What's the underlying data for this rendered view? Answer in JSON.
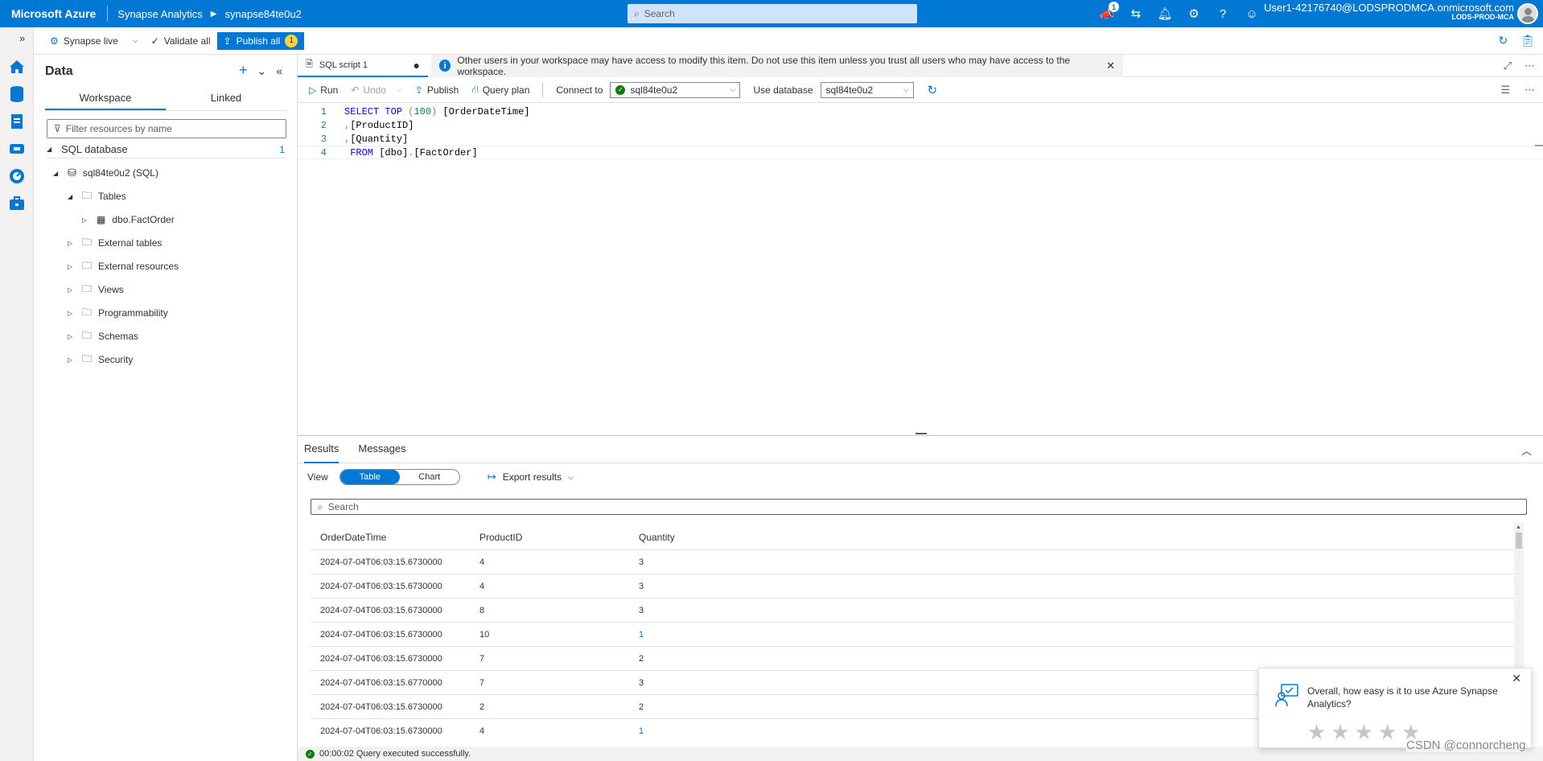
{
  "topbar": {
    "brand": "Microsoft Azure",
    "breadcrumb": [
      "Synapse Analytics",
      "synapse84te0u2"
    ],
    "search_placeholder": "Search",
    "notification_count": "1",
    "user_name": "User1-42176740@LODSPRODMCA.onmicrosoft.com",
    "user_tenant": "LODS-PROD-MCA"
  },
  "commandbar": {
    "mode": "Synapse live",
    "validate_all": "Validate all",
    "publish_all": "Publish all",
    "publish_count": "1"
  },
  "data_panel": {
    "title": "Data",
    "tabs": [
      "Workspace",
      "Linked"
    ],
    "filter_placeholder": "Filter resources by name",
    "section": "SQL database",
    "section_count": "1",
    "database": "sql84te0u2 (SQL)",
    "tables_folder": "Tables",
    "table_item": "dbo.FactOrder",
    "folders": [
      "External tables",
      "External resources",
      "Views",
      "Programmability",
      "Schemas",
      "Security"
    ]
  },
  "editor": {
    "tab_label": "SQL script 1",
    "tab_modified": "●",
    "info_message": "Other users in your workspace may have access to modify this item. Do not use this item unless you trust all users who may have access to the workspace.",
    "toolbar": {
      "run": "Run",
      "undo": "Undo",
      "publish": "Publish",
      "query_plan": "Query plan",
      "connect_to_label": "Connect to",
      "connect_to_value": "sql84te0u2",
      "use_database_label": "Use database",
      "use_database_value": "sql84te0u2"
    },
    "line_numbers": [
      "1",
      "2",
      "3",
      "4"
    ]
  },
  "results": {
    "tabs": [
      "Results",
      "Messages"
    ],
    "view_label": "View",
    "view_options": [
      "Table",
      "Chart"
    ],
    "export_label": "Export results",
    "search_placeholder": "Search",
    "columns": [
      "OrderDateTime",
      "ProductID",
      "Quantity"
    ],
    "rows": [
      [
        "2024-07-04T06:03:15.6730000",
        "4",
        "3"
      ],
      [
        "2024-07-04T06:03:15.6730000",
        "4",
        "3"
      ],
      [
        "2024-07-04T06:03:15.6730000",
        "8",
        "3"
      ],
      [
        "2024-07-04T06:03:15.6730000",
        "10",
        "1"
      ],
      [
        "2024-07-04T06:03:15.6730000",
        "7",
        "2"
      ],
      [
        "2024-07-04T06:03:15.6770000",
        "7",
        "3"
      ],
      [
        "2024-07-04T06:03:15.6730000",
        "2",
        "2"
      ],
      [
        "2024-07-04T06:03:15.6730000",
        "4",
        "1"
      ]
    ]
  },
  "status": {
    "message": "00:00:02 Query executed successfully."
  },
  "survey": {
    "question": "Overall, how easy is it to use Azure Synapse Analytics?"
  },
  "watermark": "CSDN @connorcheng"
}
